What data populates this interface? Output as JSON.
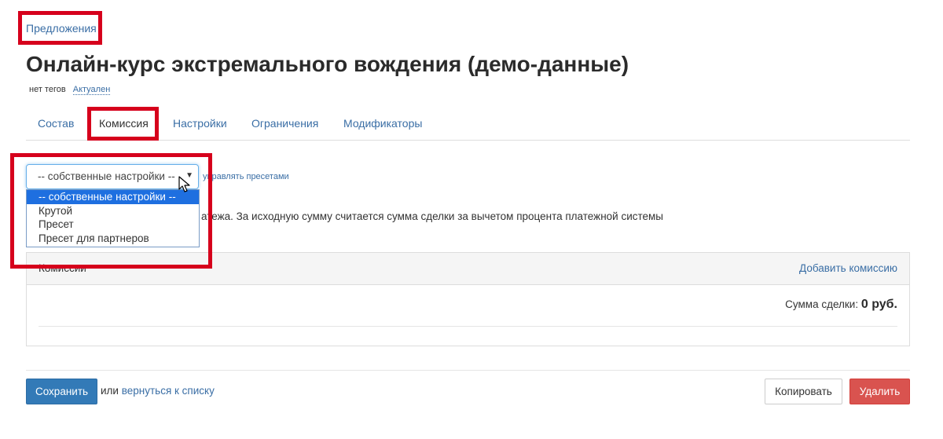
{
  "breadcrumb": {
    "label": "Предложения"
  },
  "page": {
    "title": "Онлайн-курс экстремального вождения (демо-данные)",
    "tags": "нет тегов",
    "status": "Актуален"
  },
  "tabs": [
    {
      "label": "Состав"
    },
    {
      "label": "Комиссия"
    },
    {
      "label": "Настройки"
    },
    {
      "label": "Ограничения"
    },
    {
      "label": "Модификаторы"
    }
  ],
  "preset": {
    "selected": "-- собственные настройки --",
    "options": [
      "-- собственные настройки --",
      "Крутой",
      "Пресет",
      "Пресет для партнеров"
    ],
    "manage_link": "управлять пресетами",
    "description": "атежа. За исходную сумму считается сумма сделки за вычетом процента платежной системы"
  },
  "commission_panel": {
    "title": "Комиссии",
    "add_label": "Добавить комиссию",
    "deal_sum_label": "Сумма сделки:",
    "deal_sum_value": "0 руб."
  },
  "footer": {
    "save_label": "Сохранить",
    "or_text": "или",
    "back_link": "вернуться к списку",
    "copy_label": "Копировать",
    "delete_label": "Удалить"
  },
  "colors": {
    "link": "#3a6ea5",
    "primary": "#337ab7",
    "danger": "#d9534f",
    "highlight": "#d6001c",
    "option_selected": "#1e6fe0"
  }
}
